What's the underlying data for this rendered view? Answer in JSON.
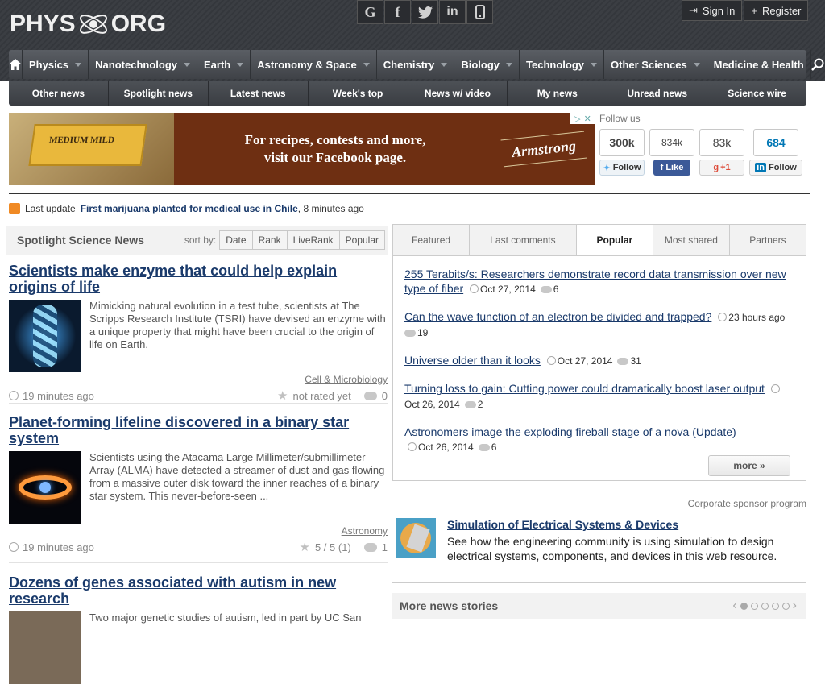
{
  "header": {
    "logo_left": "PHYS",
    "logo_right": "ORG",
    "social": [
      "G",
      "f",
      "t",
      "in",
      "▯"
    ],
    "signin": "Sign In",
    "register": "Register"
  },
  "nav": {
    "items": [
      "Physics",
      "Nanotechnology",
      "Earth",
      "Astronomy & Space",
      "Chemistry",
      "Biology",
      "Technology",
      "Other Sciences",
      "Medicine & Health"
    ]
  },
  "subnav": {
    "items": [
      "Other news",
      "Spotlight news",
      "Latest news",
      "Week's top",
      "News w/ video",
      "My news",
      "Unread news",
      "Science wire"
    ]
  },
  "ad": {
    "line1": "For recipes, contests and more,",
    "line2": "visit our Facebook page.",
    "brand": "Armstrong",
    "product": "MEDIUM MILD"
  },
  "follow": {
    "title": "Follow us",
    "twitter_count": "300k",
    "twitter_btn": "Follow",
    "facebook_count": "834k",
    "facebook_btn": "Like",
    "google_count": "83k",
    "google_btn": "+1",
    "linkedin_count": "684",
    "linkedin_btn": "Follow"
  },
  "lastupdate": {
    "prefix": "Last update",
    "link": "First marijuana planted for medical use in Chile",
    "suffix": ", 8 minutes ago"
  },
  "spotlight": {
    "title": "Spotlight Science News",
    "sortby_label": "sort by:",
    "sort_options": [
      "Date",
      "Rank",
      "LiveRank",
      "Popular"
    ]
  },
  "articles": [
    {
      "title": "Scientists make enzyme that could help explain origins of life",
      "summary": "Mimicking natural evolution in a test tube, scientists at The Scripps Research Institute (TSRI) have devised an enzyme with a unique property that might have been crucial to the origin of life on Earth.",
      "category": "Cell & Microbiology",
      "time": "19 minutes ago",
      "rating": "not rated yet",
      "comments": "0"
    },
    {
      "title": "Planet-forming lifeline discovered in a binary star system",
      "summary": "Scientists using the Atacama Large Millimeter/submillimeter Array (ALMA) have detected a streamer of dust and gas flowing from a massive outer disk toward the inner reaches of a binary star system. This never-before-seen ...",
      "category": "Astronomy",
      "time": "19 minutes ago",
      "rating": "5 / 5 (1)",
      "comments": "1"
    },
    {
      "title": "Dozens of genes associated with autism in new research",
      "summary": "Two major genetic studies of autism, led in part by UC San"
    }
  ],
  "tabs": [
    "Featured",
    "Last comments",
    "Popular",
    "Most shared",
    "Partners"
  ],
  "popular": [
    {
      "title": "255 Terabits/s: Researchers demonstrate record data transmission over new type of fiber",
      "date": "Oct 27, 2014",
      "comments": "6"
    },
    {
      "title": "Can the wave function of an electron be divided and trapped?",
      "date": "23 hours ago",
      "comments": "19"
    },
    {
      "title": "Universe older than it looks",
      "date": "Oct 27, 2014",
      "comments": "31"
    },
    {
      "title": "Turning loss to gain: Cutting power could dramatically boost laser output",
      "date": "Oct 26, 2014",
      "comments": "2"
    },
    {
      "title": "Astronomers image the exploding fireball stage of a nova (Update)",
      "date": "Oct 26, 2014",
      "comments": "6"
    }
  ],
  "more_label": "more »",
  "sponsor": {
    "label": "Corporate sponsor program",
    "title": "Simulation of Electrical Systems & Devices",
    "text": "See how the engineering community is using simulation to design electrical systems, components, and devices in this web resource."
  },
  "morenews": {
    "title": "More news stories"
  },
  "colors": {
    "link": "#1a3a6b",
    "header_bg": "#3a3d42",
    "twitter": "#55acee",
    "facebook": "#3b5998",
    "google": "#dd4b39",
    "linkedin": "#0077b5"
  }
}
